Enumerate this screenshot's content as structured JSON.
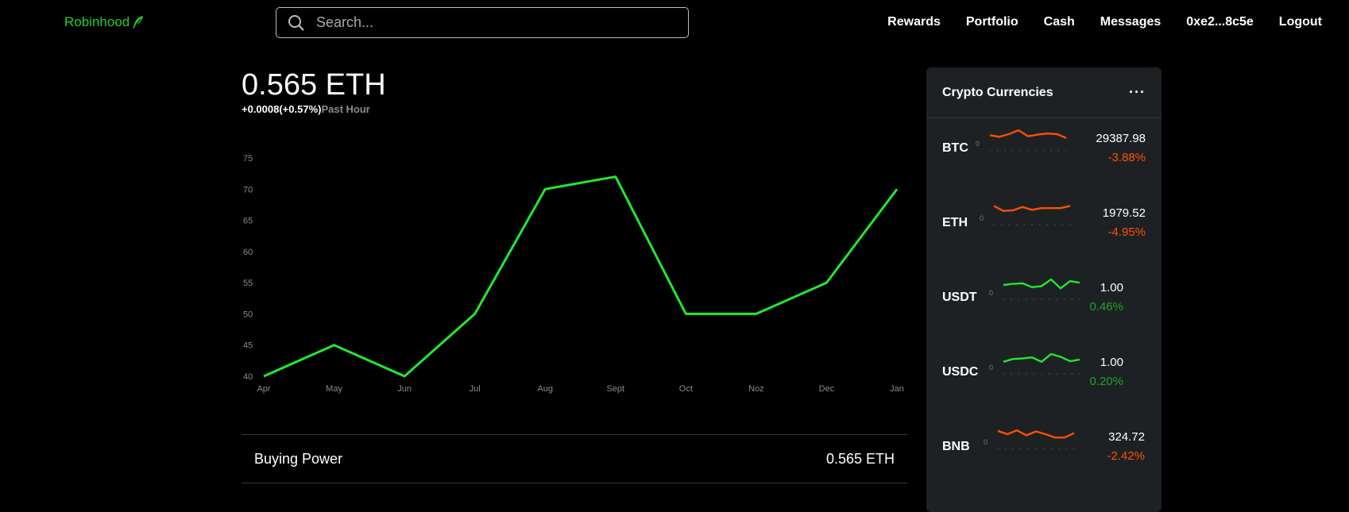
{
  "brand": {
    "name": "Robinhood",
    "color": "#21ce2f"
  },
  "search": {
    "placeholder": "Search..."
  },
  "nav": [
    "Rewards",
    "Portfolio",
    "Cash",
    "Messages",
    "0xe2...8c5e",
    "Logout"
  ],
  "balance": {
    "amount": "0.565 ETH",
    "change": "+0.0008(+0.57%)",
    "period": "Past Hour"
  },
  "chart_data": {
    "type": "line",
    "categories": [
      "Apr",
      "May",
      "Jun",
      "Jul",
      "Aug",
      "Sept",
      "Oct",
      "Noz",
      "Dec",
      "Jan"
    ],
    "values": [
      40,
      45,
      40,
      50,
      70,
      72,
      50,
      50,
      55,
      70
    ],
    "yticks": [
      "40",
      "45",
      "50",
      "55",
      "60",
      "65",
      "70",
      "75"
    ],
    "ylim": [
      40,
      75
    ],
    "color": "#21e82f",
    "grid": false,
    "title": "",
    "xlabel": "",
    "ylabel": ""
  },
  "buying_power": {
    "label": "Buying Power",
    "value": "0.565 ETH"
  },
  "crypto": {
    "title": "Crypto Currencies",
    "items": [
      {
        "symbol": "BTC",
        "price": "29387.98",
        "change": "-3.88%",
        "color": "#ff5000",
        "spark": [
          0.55,
          0.4,
          0.65,
          1.0,
          0.45,
          0.6,
          0.7,
          0.65,
          0.3
        ]
      },
      {
        "symbol": "ETH",
        "price": "1979.52",
        "change": "-4.95%",
        "color": "#ff5000",
        "spark": [
          0.9,
          0.45,
          0.5,
          0.8,
          0.55,
          0.7,
          0.7,
          0.7,
          0.9
        ]
      },
      {
        "symbol": "USDT",
        "price": "1.00",
        "change": "0.46%",
        "color": "#21e82f",
        "spark": [
          0.5,
          0.6,
          0.65,
          0.3,
          0.4,
          1.0,
          0.2,
          0.85,
          0.7
        ]
      },
      {
        "symbol": "USDC",
        "price": "1.00",
        "change": "0.20%",
        "color": "#21e82f",
        "spark": [
          0.3,
          0.55,
          0.6,
          0.7,
          0.3,
          1.0,
          0.75,
          0.35,
          0.5
        ]
      },
      {
        "symbol": "BNB",
        "price": "324.72",
        "change": "-2.42%",
        "color": "#ff5000",
        "spark": [
          0.8,
          0.5,
          0.85,
          0.4,
          0.75,
          0.5,
          0.2,
          0.2,
          0.6
        ]
      }
    ]
  }
}
